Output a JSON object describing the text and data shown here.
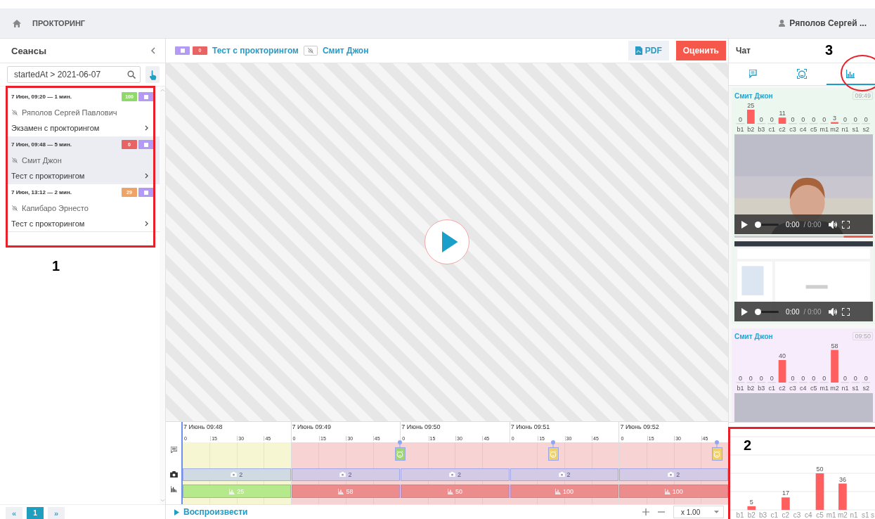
{
  "top_bar": {
    "title": "ПРОКТОРИНГ",
    "user": "Ряполов Сергей ..."
  },
  "sessions_panel": {
    "title": "Сеансы",
    "filter": {
      "value": "startedAt > 2021-06-07"
    },
    "sessions": [
      {
        "time": "7 Июн, 09:20 — 1 мин.",
        "score": {
          "text": "100",
          "color": "#8fd96b"
        },
        "name": "Ряполов Сергей Павлович",
        "test": "Экзамен с прокторингом",
        "selected": false
      },
      {
        "time": "7 Июн, 09:48 — 5 мин.",
        "score": {
          "text": "0",
          "color": "#e86464"
        },
        "name": "Смит Джон",
        "test": "Тест с прокторингом",
        "selected": true
      },
      {
        "time": "7 Июн, 13:12 — 2 мин.",
        "score": {
          "text": "29",
          "color": "#eda466"
        },
        "name": "Капибаро Эрнесто",
        "test": "Тест с прокторингом",
        "selected": false
      }
    ],
    "pagination": {
      "prev": "«",
      "page": "1",
      "next": "»"
    }
  },
  "session_header": {
    "score": {
      "text": "0",
      "color": "#e86464"
    },
    "test": "Тест с прокторингом",
    "user": "Смит Джон",
    "buttons": [
      {
        "kind": "pdf",
        "label": "PDF"
      },
      {
        "kind": "rate",
        "label": "Оценить"
      }
    ]
  },
  "timeline": {
    "minutes": [
      {
        "label": "7 Июнь 09:48",
        "ticks": [
          "0",
          "15",
          "30",
          "45"
        ],
        "zone": {
          "color": "#f7f6d2"
        },
        "camera": {
          "count": "2",
          "color": "#cfdae2"
        },
        "score": {
          "value": "25",
          "color": "#b6e88c"
        }
      },
      {
        "label": "7 Июнь 09:49",
        "ticks": [
          "0",
          "15",
          "30",
          "45"
        ],
        "zone": {
          "color": "#f7d3d3"
        },
        "camera": {
          "count": "2",
          "color": "#d3cbe6"
        },
        "score": {
          "value": "58",
          "color": "#ec8c8c"
        }
      },
      {
        "label": "7 Июнь 09:50",
        "ticks": [
          "0",
          "15",
          "30",
          "45"
        ],
        "zone": {
          "color": "#f7d3d3"
        },
        "camera": {
          "count": "2",
          "color": "#d3cbe6"
        },
        "score": {
          "value": "50",
          "color": "#ec8c8c"
        }
      },
      {
        "label": "7 Июнь 09:51",
        "ticks": [
          "0",
          "15",
          "30",
          "45"
        ],
        "zone": {
          "color": "#f7d3d3"
        },
        "camera": {
          "count": "2",
          "color": "#d3cbe6"
        },
        "score": {
          "value": "100",
          "color": "#ec8c8c"
        }
      },
      {
        "label": "7 Июнь 09:52",
        "ticks": [
          "0",
          "15",
          "30",
          "45"
        ],
        "zone": {
          "color": "#f7d3d3"
        },
        "camera": {
          "count": "2",
          "color": "#d3cbe6"
        },
        "score": {
          "value": "100",
          "color": "#ec8c8c"
        }
      }
    ],
    "events": [
      {
        "level": 0.4,
        "color": "#9fd66e"
      },
      {
        "level": 0.68,
        "color": "#f0d06a"
      },
      {
        "level": 0.98,
        "color": "#f0d06a"
      }
    ],
    "play": "Воспроизвести",
    "speed": "x 1.00"
  },
  "right_panel": {
    "title": "Чат",
    "tabs": [
      {
        "kind": "chat",
        "selected": false
      },
      {
        "kind": "face",
        "selected": false
      },
      {
        "kind": "chart",
        "selected": true
      }
    ],
    "cards": [
      {
        "name": "Смит Джон",
        "time": "09:49",
        "color": "#ebf7ef",
        "chart_data": {
          "type": "bar",
          "categories": [
            "b1",
            "b2",
            "b3",
            "c1",
            "c2",
            "c3",
            "c4",
            "c5",
            "m1",
            "m2",
            "n1",
            "s1",
            "s2"
          ],
          "values": [
            0,
            25,
            0,
            0,
            11,
            0,
            0,
            0,
            0,
            3,
            0,
            0,
            0
          ],
          "data_labels": true
        },
        "videos": [
          {
            "kind": "camera",
            "player": {
              "level": 0,
              "current": "0:00",
              "total": "/ 0:00"
            }
          },
          {
            "kind": "screen",
            "player": {
              "level": 0,
              "current": "0:00",
              "total": "/ 0:00"
            }
          }
        ]
      },
      {
        "name": "Смит Джон",
        "time": "09:50",
        "color": "#f6ecfb",
        "chart_data": {
          "type": "bar",
          "categories": [
            "b1",
            "b2",
            "b3",
            "c1",
            "c2",
            "c3",
            "c4",
            "c5",
            "m1",
            "m2",
            "n1",
            "s1",
            "s2"
          ],
          "values": [
            0,
            0,
            0,
            0,
            40,
            0,
            0,
            0,
            0,
            58,
            0,
            0,
            0
          ],
          "data_labels": true
        },
        "videos": [
          {
            "kind": "camera"
          }
        ]
      }
    ],
    "summary": {
      "chart_data": {
        "type": "bar",
        "categories": [
          "b1",
          "b2",
          "b3",
          "c1",
          "c2",
          "c3",
          "c4",
          "c5",
          "m1",
          "m2",
          "n1",
          "s1"
        ],
        "values": [
          0,
          5,
          0,
          0,
          17,
          0,
          0,
          50,
          0,
          36,
          0,
          0
        ],
        "value_labels": [
          null,
          "5",
          null,
          null,
          "17",
          null,
          null,
          "50",
          null,
          "36",
          null,
          null
        ],
        "ylim": [
          0,
          100
        ],
        "yticks": [
          0,
          25,
          50,
          75,
          100
        ],
        "grid": true
      },
      "cut_category": "s"
    }
  },
  "annotations": [
    {
      "kind": "frame",
      "label": "1"
    },
    {
      "kind": "frame",
      "label": "2"
    },
    {
      "kind": "circle",
      "label": "3"
    }
  ]
}
